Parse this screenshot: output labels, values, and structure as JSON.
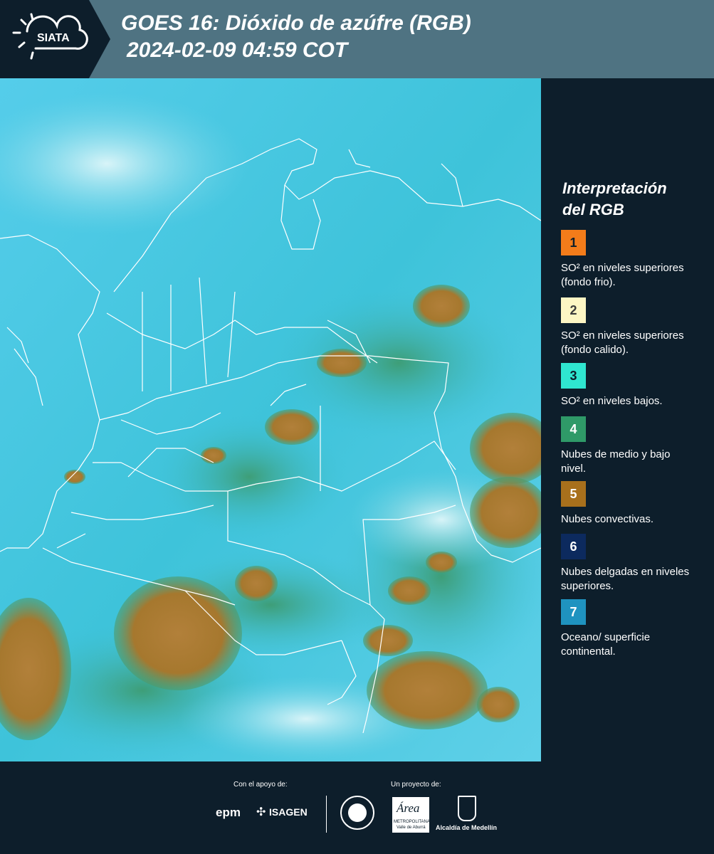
{
  "header": {
    "logo_text": "SIATA",
    "title_line1": "GOES 16: Dióxido de azúfre (RGB)",
    "title_line2": "2024-02-09 04:59 COT"
  },
  "legend": {
    "title_line1": "Interpretación",
    "title_line2": "del RGB",
    "items": [
      {
        "number": "1",
        "label": "SO² en niveles superiores (fondo frio).",
        "color": "#f37c1a"
      },
      {
        "number": "2",
        "label": "SO² en niveles superiores (fondo calido).",
        "color": "#fdf6c4"
      },
      {
        "number": "3",
        "label": "SO² en niveles bajos.",
        "color": "#2fe6d0"
      },
      {
        "number": "4",
        "label": "Nubes de medio y bajo nivel.",
        "color": "#2f9a68"
      },
      {
        "number": "5",
        "label": "Nubes convectivas.",
        "color": "#a8701c"
      },
      {
        "number": "6",
        "label": "Nubes delgadas en niveles superiores.",
        "color": "#0c2a5e"
      },
      {
        "number": "7",
        "label": "Oceano/ superficie continental.",
        "color": "#1f93c0"
      }
    ]
  },
  "footer": {
    "support_label": "Con el apoyo de:",
    "project_label": "Un proyecto de:",
    "sponsor1": "epm",
    "sponsor2": "ISAGEN",
    "partner1": "Área",
    "partner1_sub": "METROPOLITANA",
    "partner1_sub2": "Valle de Aburrá",
    "partner2": "Alcaldía de Medellín"
  }
}
